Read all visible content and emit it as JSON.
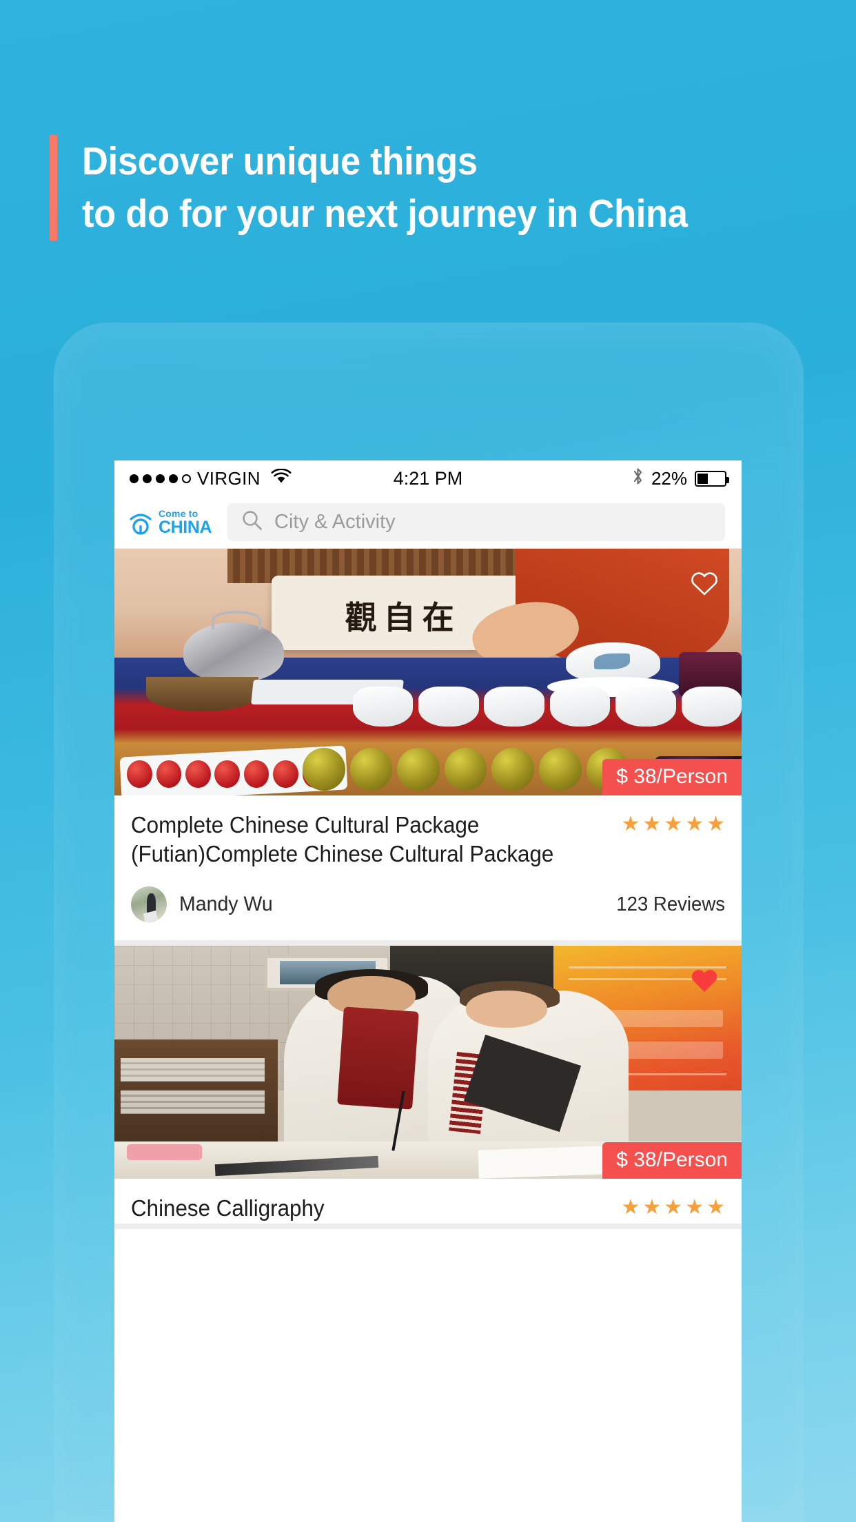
{
  "page": {
    "background_color": "#2fb2dc",
    "accent_bar_color": "#f87a66"
  },
  "headline": {
    "line1": "Discover unique things",
    "line2": "to do for your next journey in China"
  },
  "status_bar": {
    "carrier": "VIRGIN",
    "signal_dots_filled": 4,
    "signal_dots_total": 5,
    "wifi_icon": "wifi-icon",
    "time": "4:21 PM",
    "bluetooth_icon": "bluetooth-icon",
    "battery_percent": "22%",
    "battery_level": 22
  },
  "app_header": {
    "logo": {
      "mark": "come-to-china-logo-icon",
      "line1": "Come to",
      "line2": "CHINA",
      "color": "#1ba3ec"
    },
    "search": {
      "icon": "search-icon",
      "placeholder": "City & Activity",
      "value": ""
    }
  },
  "feed": {
    "cards": [
      {
        "image_alt": "chinese-tea-ceremony-table",
        "favorite_icon": "heart-outline-icon",
        "favorited": false,
        "price": "$ 38/Person",
        "price_color": "#f4504d",
        "title": "Complete Chinese Cultural Package (Futian)Complete Chinese Cultural Package",
        "rating": 5,
        "rating_max": 5,
        "star_color": "#f5a03c",
        "author": "Mandy Wu",
        "author_avatar": "user-avatar",
        "reviews": "123 Reviews"
      },
      {
        "image_alt": "chinese-calligraphy-lesson",
        "favorite_icon": "heart-filled-icon",
        "favorited": true,
        "price": "$ 38/Person",
        "price_color": "#f4504d",
        "title": "Chinese Calligraphy",
        "rating": 5,
        "rating_max": 5,
        "star_color": "#f5a03c",
        "author": "",
        "reviews": ""
      }
    ]
  },
  "decor": {
    "calligraphy_characters": "觀自在"
  }
}
